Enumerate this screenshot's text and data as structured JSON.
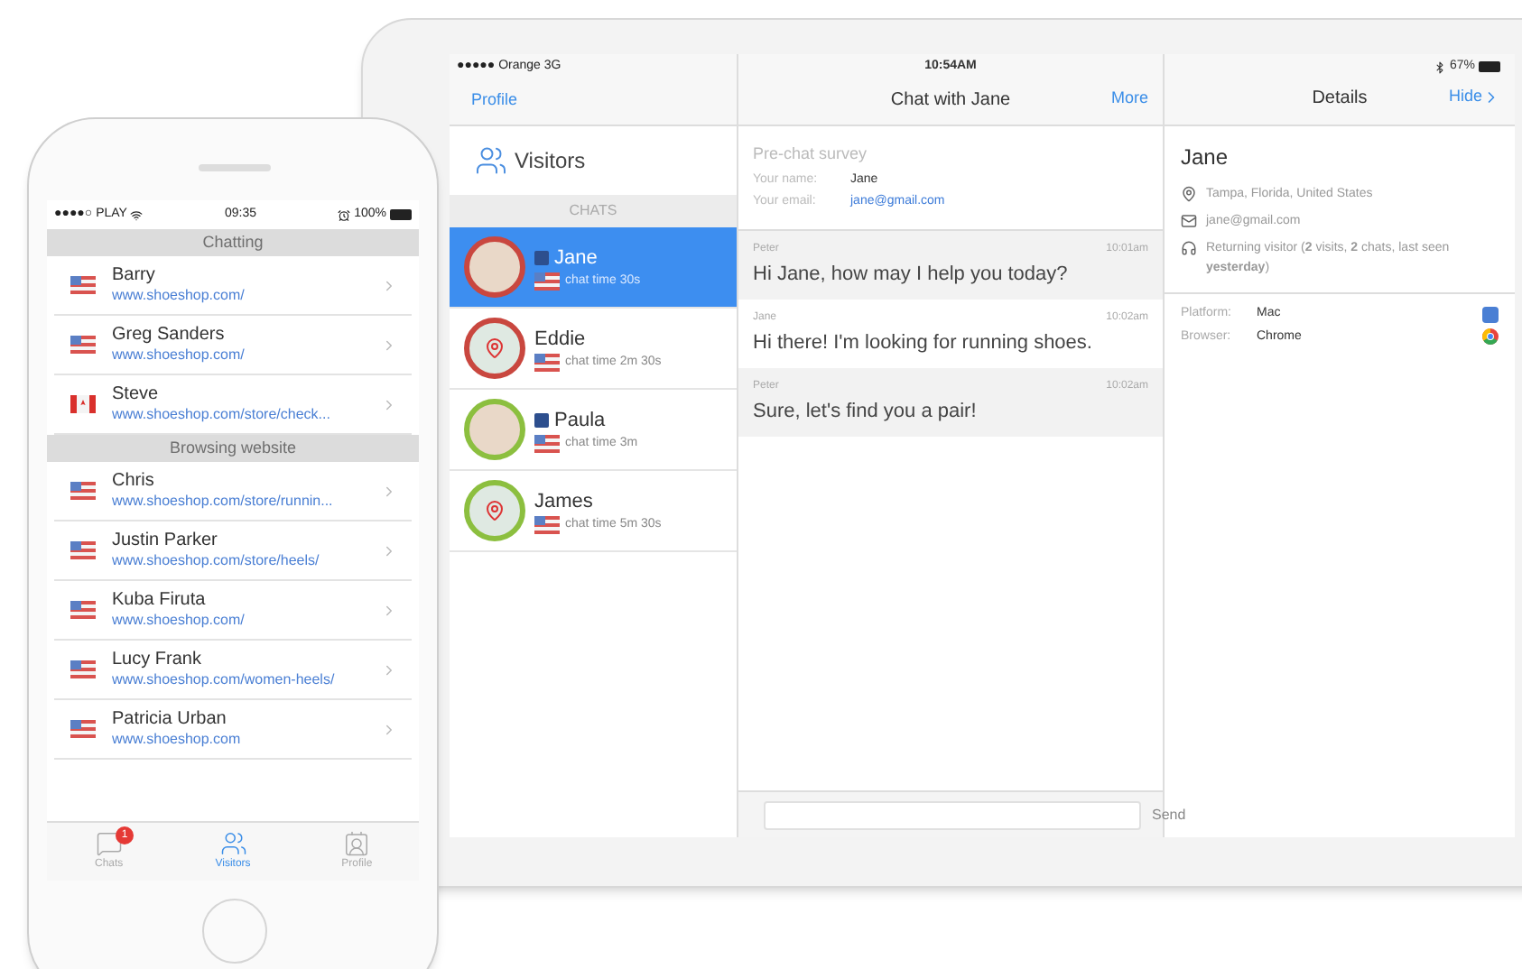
{
  "tablet": {
    "status_bar": {
      "carrier": "●●●●● Orange  3G",
      "time": "10:54AM",
      "battery": "67%"
    },
    "left_panel": {
      "nav_link": "Profile",
      "visitors_label": "Visitors",
      "section": "CHATS",
      "chats": [
        {
          "name": "Jane",
          "duration": "chat time 30s",
          "selected": true,
          "color": "#c9473f",
          "kind": "photo",
          "facebook": true
        },
        {
          "name": "Eddie",
          "duration": "chat time 2m 30s",
          "selected": false,
          "color": "#c9473f",
          "kind": "map",
          "facebook": false
        },
        {
          "name": "Paula",
          "duration": "chat time 3m",
          "selected": false,
          "color": "#8cbf3f",
          "kind": "photo",
          "facebook": true
        },
        {
          "name": "James",
          "duration": "chat time 5m 30s",
          "selected": false,
          "color": "#8cbf3f",
          "kind": "map",
          "facebook": false
        }
      ]
    },
    "chat_panel": {
      "title": "Chat with Jane",
      "action": "More",
      "survey": {
        "title": "Pre-chat survey",
        "fields": [
          {
            "label": "Your name:",
            "value": "Jane",
            "kind": "text"
          },
          {
            "label": "Your email:",
            "value": "jane@gmail.com",
            "kind": "link"
          }
        ]
      },
      "messages": [
        {
          "author": "Peter",
          "time": "10:01am",
          "text": "Hi Jane, how may I help you today?",
          "kind": "agent"
        },
        {
          "author": "Jane",
          "time": "10:02am",
          "text": "Hi there! I'm looking for running shoes.",
          "kind": "visitor"
        },
        {
          "author": "Peter",
          "time": "10:02am",
          "text": "Sure, let's find you a pair!",
          "kind": "agent"
        }
      ],
      "composer": {
        "button": "Send"
      }
    },
    "details_panel": {
      "title": "Details",
      "action": "Hide",
      "name": "Jane",
      "info": [
        {
          "kind": "location",
          "text": "Tampa, Florida, United States"
        },
        {
          "kind": "email",
          "text": "jane@gmail.com"
        },
        {
          "kind": "returning",
          "text": "Returning visitor (**2** visits, **2** chats, last seen **yesterday**)"
        }
      ],
      "system": [
        {
          "label": "Platform:",
          "value": "Mac",
          "kind": "mac"
        },
        {
          "label": "Browser:",
          "value": "Chrome",
          "kind": "chrome"
        }
      ]
    }
  },
  "phone": {
    "status_bar": {
      "carrier": "●●●●○ PLAY",
      "time": "09:35",
      "battery": "100%"
    },
    "sections": [
      {
        "title": "Chatting",
        "visitors": [
          {
            "name": "Barry",
            "url": "www.shoeshop.com/",
            "kind": "us"
          },
          {
            "name": "Greg Sanders",
            "url": "www.shoeshop.com/",
            "kind": "us"
          },
          {
            "name": "Steve",
            "url": "www.shoeshop.com/store/check...",
            "kind": "ca"
          }
        ]
      },
      {
        "title": "Browsing website",
        "visitors": [
          {
            "name": "Chris",
            "url": "www.shoeshop.com/store/runnin...",
            "kind": "us"
          },
          {
            "name": "Justin Parker",
            "url": "www.shoeshop.com/store/heels/",
            "kind": "us"
          },
          {
            "name": "Kuba Firuta",
            "url": "www.shoeshop.com/",
            "kind": "us"
          },
          {
            "name": "Lucy Frank",
            "url": "www.shoeshop.com/women-heels/",
            "kind": "us"
          },
          {
            "name": "Patricia Urban",
            "url": "www.shoeshop.com",
            "kind": "us"
          }
        ]
      }
    ],
    "tabs": [
      {
        "label": "Chats",
        "selected": false,
        "kind": "chats",
        "badge": "1"
      },
      {
        "label": "Visitors",
        "selected": true,
        "kind": "visitors"
      },
      {
        "label": "Profile",
        "selected": false,
        "kind": "profile"
      }
    ]
  }
}
